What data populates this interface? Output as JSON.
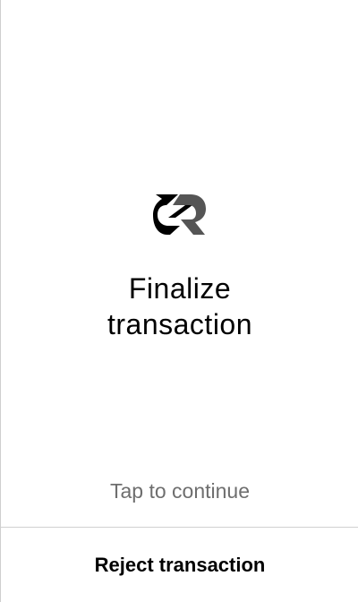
{
  "brand": {
    "logo_icon": "decred-logo-icon",
    "colors": {
      "primary": "#000000",
      "secondary": "#555555"
    }
  },
  "main": {
    "title_line1": "Finalize",
    "title_line2": "transaction",
    "hint": "Tap to continue"
  },
  "footer": {
    "reject_label": "Reject transaction"
  },
  "colors": {
    "background": "#ffffff",
    "hint_text": "#6e6e6e",
    "divider": "#d0d0d0"
  }
}
